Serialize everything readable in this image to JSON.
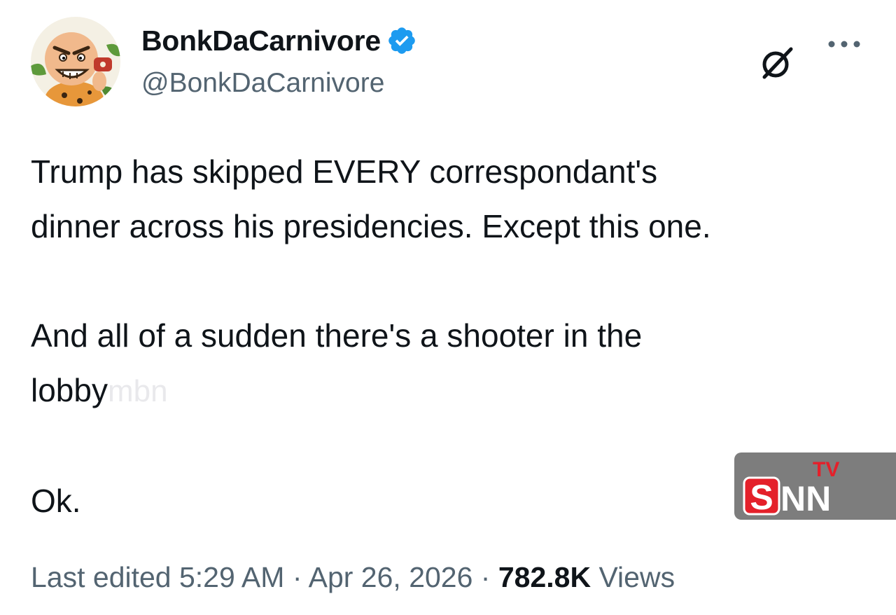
{
  "author": {
    "display_name": "BonkDaCarnivore",
    "handle": "@BonkDaCarnivore",
    "verified": true,
    "verified_color": "#1d9bf0",
    "avatar_icon": "cartoon-caveman-avatar"
  },
  "header_actions": {
    "grok_icon": "grok-icon",
    "more_icon": "more-icon"
  },
  "tweet": {
    "line1": "Trump has skipped EVERY correspondant's",
    "line2": "dinner across his presidencies. Except this one.",
    "line3": "And all of a sudden there's a shooter in the",
    "line4": "lobby",
    "line5": "Ok."
  },
  "watermarks": {
    "mbn": "mbn",
    "snn_letters": "SNN",
    "snn_tv": "TV",
    "snn_red": "#e4202a",
    "snn_bg": "#7d7d7d"
  },
  "footer": {
    "edited": "Last edited 5:29 AM",
    "sep1": " · ",
    "date": "Apr 26, 2026",
    "sep2": " · ",
    "views_count": "782.8K",
    "views_label": " Views"
  }
}
